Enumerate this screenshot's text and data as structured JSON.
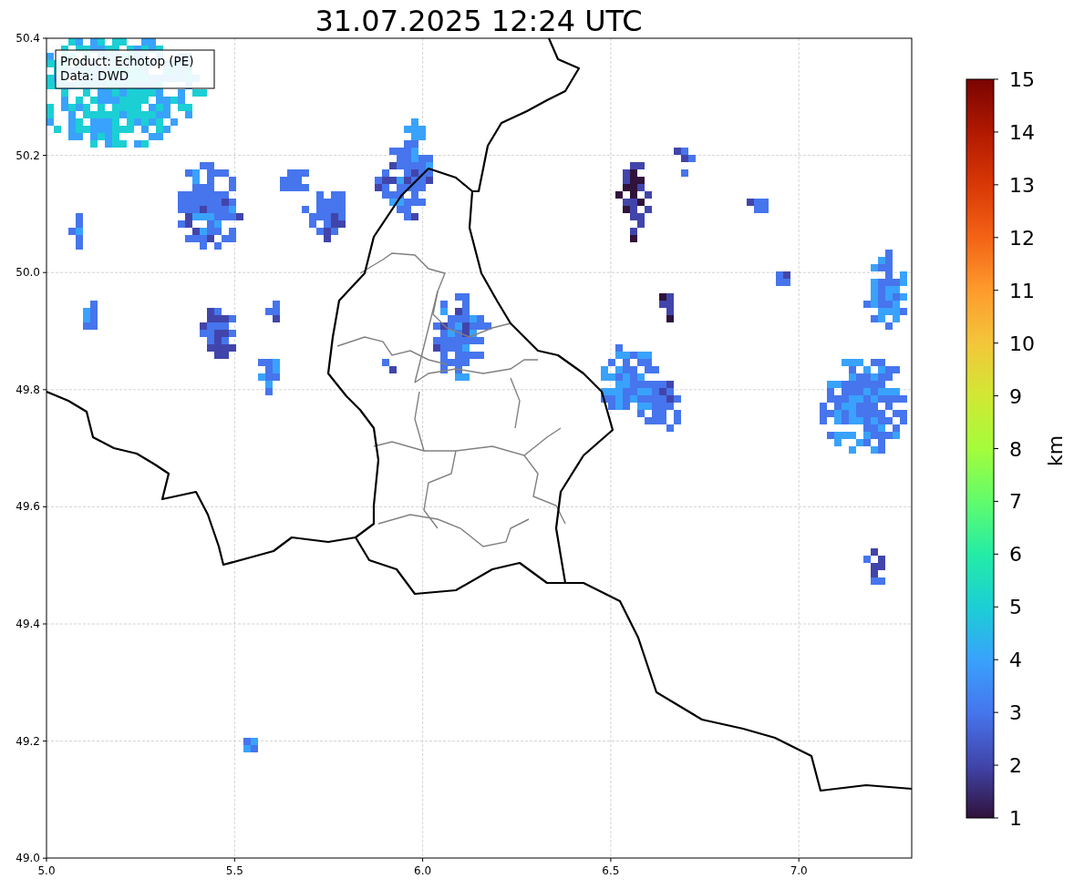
{
  "title": "31.07.2025 12:24 UTC",
  "info_box": {
    "lines": [
      "Product: Echotop (PE)",
      "Data: DWD"
    ]
  },
  "map": {
    "x_ticks": [
      "5.0",
      "5.5",
      "6.0",
      "6.5",
      "7.0"
    ],
    "y_ticks": [
      "50.4",
      "50.2",
      "50.0",
      "49.8",
      "49.6",
      "49.4",
      "49.2",
      "49.0"
    ]
  },
  "colorbar": {
    "label": "km",
    "ticks": [
      "15",
      "14",
      "13",
      "12",
      "11",
      "10",
      "9",
      "8",
      "7",
      "6",
      "5",
      "4",
      "3",
      "2",
      "1"
    ]
  }
}
